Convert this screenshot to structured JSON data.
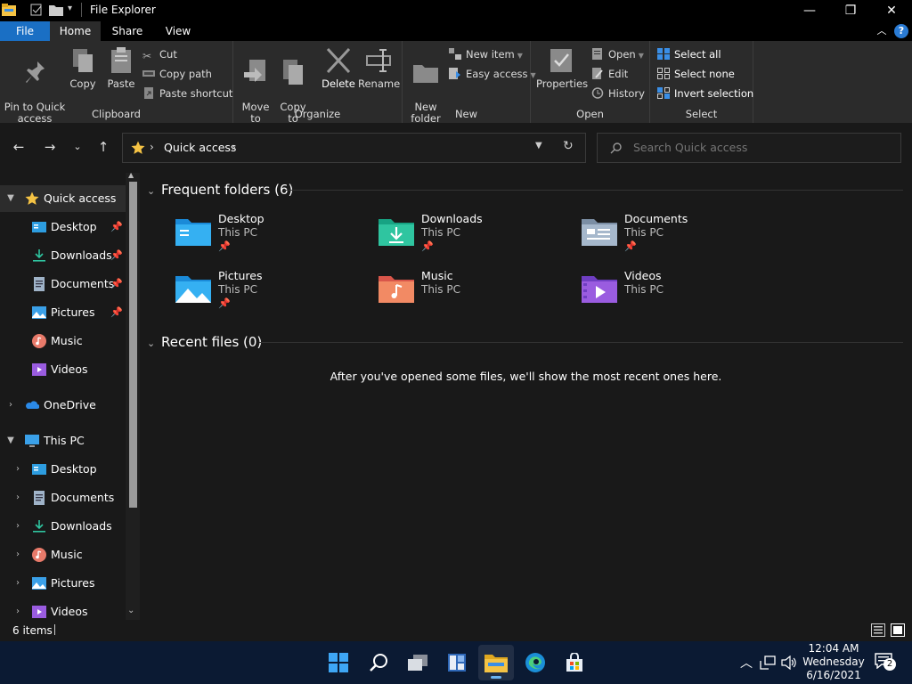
{
  "window": {
    "title": "File Explorer",
    "minimize_glyph": "—",
    "maximize_glyph": "❐",
    "close_glyph": "✕"
  },
  "tabs": [
    {
      "label": "File"
    },
    {
      "label": "Home"
    },
    {
      "label": "Share"
    },
    {
      "label": "View"
    }
  ],
  "ribbon": {
    "clipboard": {
      "pin": "Pin to Quick\naccess",
      "copy": "Copy",
      "paste": "Paste",
      "cut": "Cut",
      "copy_path": "Copy path",
      "paste_shortcut": "Paste shortcut",
      "label": "Clipboard"
    },
    "organize": {
      "move_to": "Move\nto",
      "copy_to": "Copy\nto",
      "delete": "Delete",
      "rename": "Rename",
      "label": "Organize"
    },
    "new": {
      "new_folder": "New\nfolder",
      "new_item": "New item",
      "easy_access": "Easy access",
      "label": "New"
    },
    "open": {
      "properties": "Properties",
      "open": "Open",
      "edit": "Edit",
      "history": "History",
      "label": "Open"
    },
    "select": {
      "select_all": "Select all",
      "select_none": "Select none",
      "invert": "Invert selection",
      "label": "Select"
    }
  },
  "address": {
    "path": "Quick access"
  },
  "search": {
    "placeholder": "Search Quick access"
  },
  "nav": {
    "quick_access": "Quick access",
    "qa_items": [
      {
        "label": "Desktop",
        "pinned": true
      },
      {
        "label": "Downloads",
        "pinned": true
      },
      {
        "label": "Documents",
        "pinned": true
      },
      {
        "label": "Pictures",
        "pinned": true
      },
      {
        "label": "Music",
        "pinned": false
      },
      {
        "label": "Videos",
        "pinned": false
      }
    ],
    "onedrive": "OneDrive",
    "this_pc": "This PC",
    "pc_items": [
      {
        "label": "Desktop"
      },
      {
        "label": "Documents"
      },
      {
        "label": "Downloads"
      },
      {
        "label": "Music"
      },
      {
        "label": "Pictures"
      },
      {
        "label": "Videos"
      }
    ]
  },
  "content": {
    "frequent_header": "Frequent folders (6)",
    "folders": [
      {
        "name": "Desktop",
        "location": "This PC",
        "pinned": true,
        "icon": "desktop-folder-icon"
      },
      {
        "name": "Downloads",
        "location": "This PC",
        "pinned": true,
        "icon": "downloads-folder-icon"
      },
      {
        "name": "Documents",
        "location": "This PC",
        "pinned": true,
        "icon": "documents-folder-icon"
      },
      {
        "name": "Pictures",
        "location": "This PC",
        "pinned": true,
        "icon": "pictures-folder-icon"
      },
      {
        "name": "Music",
        "location": "This PC",
        "pinned": false,
        "icon": "music-folder-icon"
      },
      {
        "name": "Videos",
        "location": "This PC",
        "pinned": false,
        "icon": "videos-folder-icon"
      }
    ],
    "recent_header": "Recent files (0)",
    "recent_message": "After you've opened some files, we'll show the most recent ones here."
  },
  "status": {
    "item_count": "6 items"
  },
  "taskbar": {
    "apps": [
      "start-icon",
      "search-icon",
      "task-view-icon",
      "widgets-icon",
      "file-explorer-icon",
      "edge-icon",
      "store-icon"
    ],
    "time": "12:04 AM",
    "day": "Wednesday",
    "date": "6/16/2021",
    "notifications": "2"
  },
  "colors": {
    "accent": "#1a6fc4",
    "taskbar": "#0b1a33",
    "background": "#191919",
    "ribbon": "#2b2b2b"
  }
}
